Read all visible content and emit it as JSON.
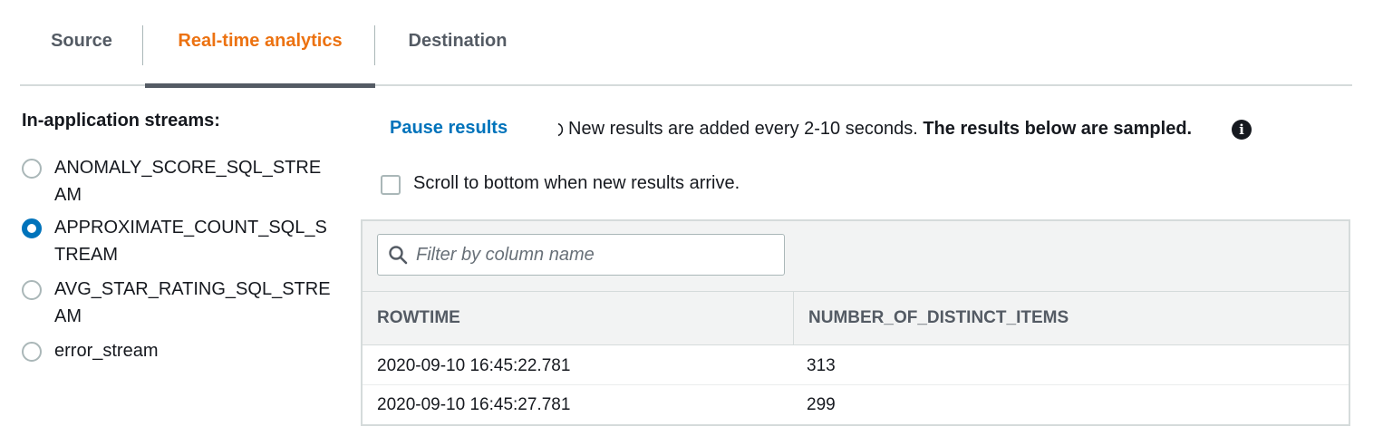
{
  "tabs": [
    {
      "label": "Source",
      "active": false
    },
    {
      "label": "Real-time analytics",
      "active": true
    },
    {
      "label": "Destination",
      "active": false
    }
  ],
  "streams": {
    "title": "In-application streams:",
    "items": [
      {
        "label": "ANOMALY_SCORE_SQL_STRE AM",
        "selected": false
      },
      {
        "label": "APPROXIMATE_COUNT_SQL_S TREAM",
        "selected": true
      },
      {
        "label": "AVG_STAR_RATING_SQL_STRE AM",
        "selected": false
      },
      {
        "label": "error_stream",
        "selected": false
      }
    ]
  },
  "controls": {
    "pause_label": "Pause results",
    "info_text": "New results are added every 2-10 seconds.",
    "info_bold": "The results below are sampled.",
    "scroll_label": "Scroll to bottom when new results arrive.",
    "scroll_checked": false
  },
  "results": {
    "filter_placeholder": "Filter by column name",
    "columns": [
      "ROWTIME",
      "NUMBER_OF_DISTINCT_ITEMS"
    ],
    "rows": [
      [
        "2020-09-10 16:45:22.781",
        "313"
      ],
      [
        "2020-09-10 16:45:27.781",
        "299"
      ]
    ]
  },
  "colors": {
    "accent_active_tab": "#ec7211",
    "link": "#0073bb",
    "text": "#16191f"
  }
}
